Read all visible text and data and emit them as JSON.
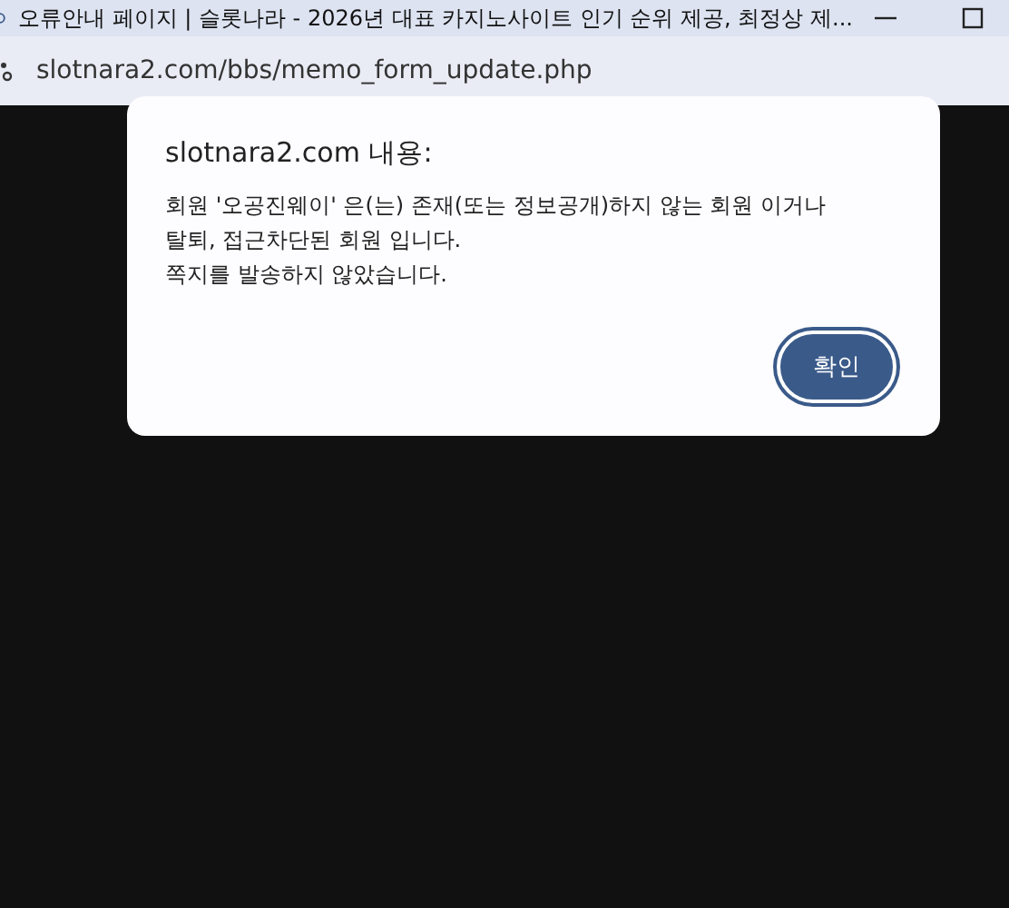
{
  "window": {
    "title": "오류안내 페이지 | 슬롯나라 - 2026년 대표 카지노사이트 인기 순위 제공, 최정상 제..."
  },
  "address_bar": {
    "url": "slotnara2.com/bbs/memo_form_update.php"
  },
  "dialog": {
    "title": "slotnara2.com 내용:",
    "message_lines": [
      "회원 '오공진웨이' 은(는) 존재(또는 정보공개)하지 않는 회원 이거나",
      "탈퇴, 접근차단된 회원 입니다.",
      "쪽지를 발송하지 않았습니다."
    ],
    "buttons": [
      "확인"
    ]
  }
}
